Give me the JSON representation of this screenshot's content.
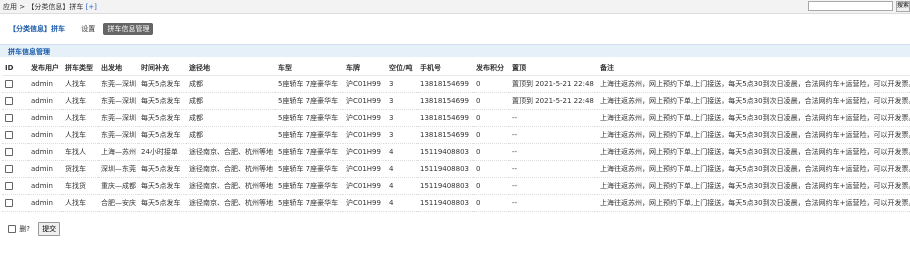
{
  "breadcrumb": {
    "text": "应用 > 【分类信息】拼车",
    "plus": "[+]"
  },
  "search": {
    "value": "",
    "button_label": "搜索"
  },
  "tabs": {
    "title": "【分类信息】拼车",
    "settings": "设置",
    "active": "拼车信息管理"
  },
  "section": {
    "title": "拼车信息管理"
  },
  "table": {
    "headers": [
      "ID",
      "发布用户",
      "拼车类型",
      "出发地",
      "时间补充",
      "途径地",
      "车型",
      "车牌",
      "空位/吨",
      "手机号",
      "发布积分",
      "置顶",
      "备注"
    ],
    "rows": [
      {
        "user": "admin",
        "type": "人找车",
        "route": "东莞—深圳",
        "time": "每天5点发车",
        "via": "成都",
        "car": "5座轿车 7座豪华车",
        "plate": "沪C01H99",
        "seats": "3",
        "phone": "13818154699",
        "points": "0",
        "top": "置顶到 2021-5-21 22:48",
        "note": "上海往返苏州，网上预约下单,上门接送，每天5点30到次日凌晨，合法网约车+运营险，可以开发票。"
      },
      {
        "user": "admin",
        "type": "人找车",
        "route": "东莞—深圳",
        "time": "每天5点发车",
        "via": "成都",
        "car": "5座轿车 7座豪华车",
        "plate": "沪C01H99",
        "seats": "3",
        "phone": "13818154699",
        "points": "0",
        "top": "置顶到 2021-5-21 22:48",
        "note": "上海往返苏州，网上预约下单,上门接送，每天5点30到次日凌晨，合法网约车+运营险，可以开发票。"
      },
      {
        "user": "admin",
        "type": "人找车",
        "route": "东莞—深圳",
        "time": "每天5点发车",
        "via": "成都",
        "car": "5座轿车 7座豪华车",
        "plate": "沪C01H99",
        "seats": "3",
        "phone": "13818154699",
        "points": "0",
        "top": "--",
        "note": "上海往返苏州，网上预约下单,上门接送，每天5点30到次日凌晨，合法网约车+运营险，可以开发票。"
      },
      {
        "user": "admin",
        "type": "人找车",
        "route": "东莞—深圳",
        "time": "每天5点发车",
        "via": "成都",
        "car": "5座轿车 7座豪华车",
        "plate": "沪C01H99",
        "seats": "3",
        "phone": "13818154699",
        "points": "0",
        "top": "--",
        "note": "上海往返苏州，网上预约下单,上门接送，每天5点30到次日凌晨，合法网约车+运营险，可以开发票。"
      },
      {
        "user": "admin",
        "type": "车找人",
        "route": "上海—苏州",
        "time": "24小时接单",
        "via": "途径南京、合肥、杭州等地",
        "car": "5座轿车 7座豪华车",
        "plate": "沪C01H99",
        "seats": "4",
        "phone": "15119408803",
        "points": "0",
        "top": "--",
        "note": "上海往返苏州，网上预约下单,上门接送，每天5点30到次日凌晨，合法网约车+运营险，可以开发票。"
      },
      {
        "user": "admin",
        "type": "货找车",
        "route": "深圳—东莞",
        "time": "每天5点发车",
        "via": "途径南京、合肥、杭州等地",
        "car": "5座轿车 7座豪华车",
        "plate": "沪C01H99",
        "seats": "4",
        "phone": "15119408803",
        "points": "0",
        "top": "--",
        "note": "上海往返苏州，网上预约下单,上门接送，每天5点30到次日凌晨，合法网约车+运营险，可以开发票。"
      },
      {
        "user": "admin",
        "type": "车找货",
        "route": "重庆—成都",
        "time": "每天5点发车",
        "via": "途径南京、合肥、杭州等地",
        "car": "5座轿车 7座豪华车",
        "plate": "沪C01H99",
        "seats": "4",
        "phone": "15119408803",
        "points": "0",
        "top": "--",
        "note": "上海往返苏州，网上预约下单,上门接送，每天5点30到次日凌晨，合法网约车+运营险，可以开发票。"
      },
      {
        "user": "admin",
        "type": "人找车",
        "route": "合肥—安庆",
        "time": "每天5点发车",
        "via": "途径南京、合肥、杭州等地",
        "car": "5座轿车 7座豪华车",
        "plate": "沪C01H99",
        "seats": "4",
        "phone": "15119408803",
        "points": "0",
        "top": "--",
        "note": "上海往返苏州，网上预约下单,上门接送，每天5点30到次日凌晨，合法网约车+运营险，可以开发票。"
      }
    ]
  },
  "footer": {
    "delete_label": "删?",
    "submit_label": "提交"
  }
}
